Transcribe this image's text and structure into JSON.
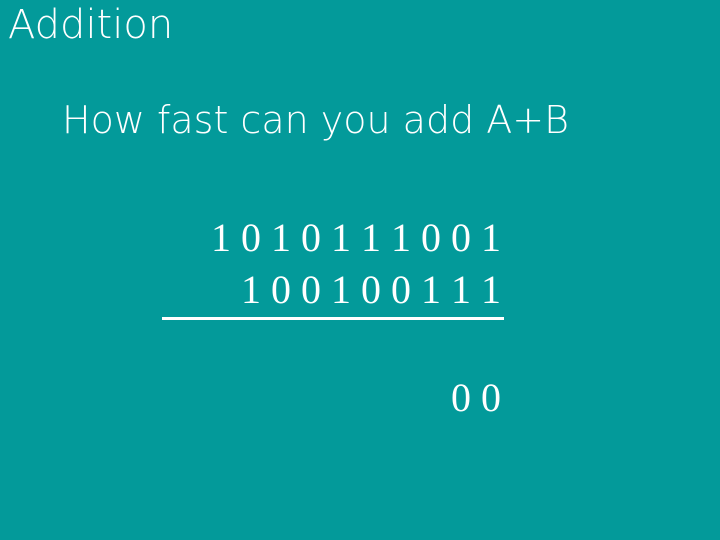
{
  "slide": {
    "title": "Addition",
    "subtitle": "How fast can you add A+B",
    "operand_a": "1 0 1 0 1 1 1 0 0 1",
    "operand_b": "1 0 0 1 0 0 1 1 1",
    "partial_result": "0 0",
    "background_color": "#039a9a",
    "text_color": "#ffffff"
  }
}
